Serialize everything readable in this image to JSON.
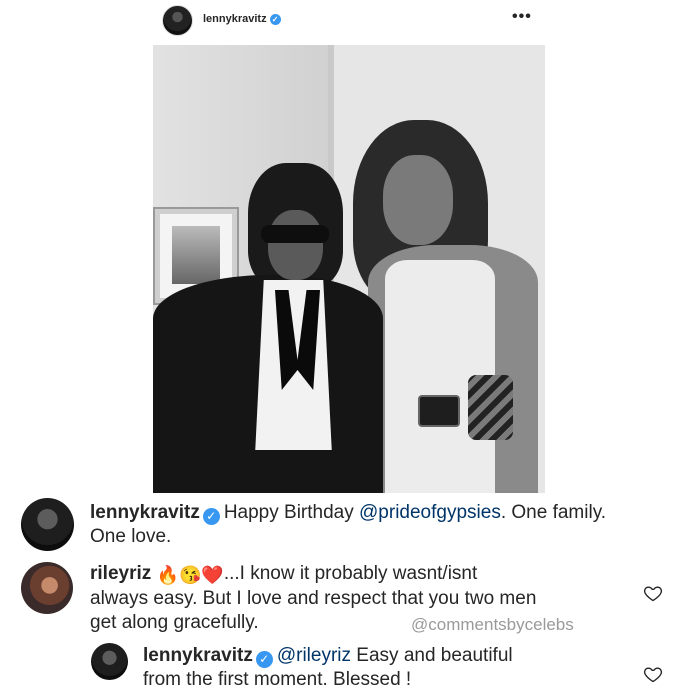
{
  "header": {
    "username": "lennykravitz",
    "more_label": "•••"
  },
  "comments": [
    {
      "username": "lennykravitz",
      "segments": [
        "Happy Birthday ",
        "@prideofgypsies",
        ". One family.",
        "One love."
      ]
    },
    {
      "username": "rileyriz",
      "emojis": [
        "🔥",
        "😘",
        "❤️"
      ],
      "lines": [
        "...I know it probably wasnt/isnt",
        "always easy. But I love and respect that you two men",
        "get along gracefully."
      ]
    },
    {
      "username": "lennykravitz",
      "mention": "@rileyriz",
      "lines": [
        " Easy and beautiful",
        "from the first moment. Blessed !"
      ]
    }
  ],
  "watermark": "@commentsbycelebs",
  "icons": {
    "verified": "verified-badge-icon",
    "like": "heart-icon",
    "more": "more-options-icon"
  },
  "colors": {
    "verified": "#3897f0",
    "mention": "#003569",
    "watermark": "#9a9a9a"
  }
}
